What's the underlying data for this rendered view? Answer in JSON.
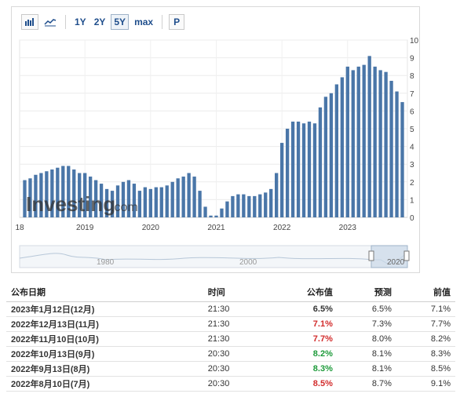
{
  "toolbar": {
    "bar_icon": "bar-chart-icon",
    "line_icon": "line-chart-icon",
    "ranges": [
      "1Y",
      "2Y",
      "5Y",
      "max"
    ],
    "active_range": "5Y",
    "p_label": "P"
  },
  "watermark": {
    "text": "Investing",
    "suffix": ".com"
  },
  "navigator": {
    "labels": [
      "1980",
      "2000",
      "2020"
    ]
  },
  "colors": {
    "bar": "#4a76a8",
    "bar_faded": "#bccee2",
    "red": "#d22c2c",
    "green": "#1d9a3a"
  },
  "chart_data": {
    "type": "bar",
    "y_axis_position": "right",
    "ylim": [
      0,
      10
    ],
    "y_ticks": [
      "0",
      "1",
      "2",
      "3",
      "4",
      "5",
      "6",
      "7",
      "8",
      "9",
      "10"
    ],
    "x_tick_labels": [
      "18",
      "2019",
      "2020",
      "2021",
      "2022",
      "2023"
    ],
    "grid": true,
    "values": [
      2.1,
      2.2,
      2.4,
      2.5,
      2.6,
      2.7,
      2.8,
      2.9,
      2.9,
      2.7,
      2.5,
      2.5,
      2.3,
      2.1,
      1.9,
      1.6,
      1.5,
      1.8,
      2.0,
      2.1,
      1.9,
      1.5,
      1.7,
      1.6,
      1.7,
      1.7,
      1.8,
      2.0,
      2.2,
      2.3,
      2.5,
      2.3,
      1.5,
      0.6,
      0.1,
      0.1,
      0.5,
      0.9,
      1.2,
      1.3,
      1.3,
      1.2,
      1.2,
      1.3,
      1.4,
      1.6,
      2.5,
      4.2,
      5.0,
      5.4,
      5.4,
      5.3,
      5.4,
      5.3,
      6.2,
      6.8,
      7.0,
      7.5,
      7.9,
      8.5,
      8.3,
      8.5,
      8.6,
      9.1,
      8.5,
      8.3,
      8.2,
      7.7,
      7.1,
      6.5
    ]
  },
  "table": {
    "headers": {
      "date": "公布日期",
      "time": "时间",
      "actual": "公布值",
      "forecast": "预测",
      "previous": "前值"
    },
    "rows": [
      {
        "date": "2023年1月12日(12月)",
        "time": "21:30",
        "actual": "6.5%",
        "actual_status": "neutral",
        "forecast": "6.5%",
        "previous": "7.1%"
      },
      {
        "date": "2022年12月13日(11月)",
        "time": "21:30",
        "actual": "7.1%",
        "actual_status": "down",
        "forecast": "7.3%",
        "previous": "7.7%"
      },
      {
        "date": "2022年11月10日(10月)",
        "time": "21:30",
        "actual": "7.7%",
        "actual_status": "down",
        "forecast": "8.0%",
        "previous": "8.2%"
      },
      {
        "date": "2022年10月13日(9月)",
        "time": "20:30",
        "actual": "8.2%",
        "actual_status": "up",
        "forecast": "8.1%",
        "previous": "8.3%"
      },
      {
        "date": "2022年9月13日(8月)",
        "time": "20:30",
        "actual": "8.3%",
        "actual_status": "up",
        "forecast": "8.1%",
        "previous": "8.5%"
      },
      {
        "date": "2022年8月10日(7月)",
        "time": "20:30",
        "actual": "8.5%",
        "actual_status": "down",
        "forecast": "8.7%",
        "previous": "9.1%"
      }
    ]
  }
}
